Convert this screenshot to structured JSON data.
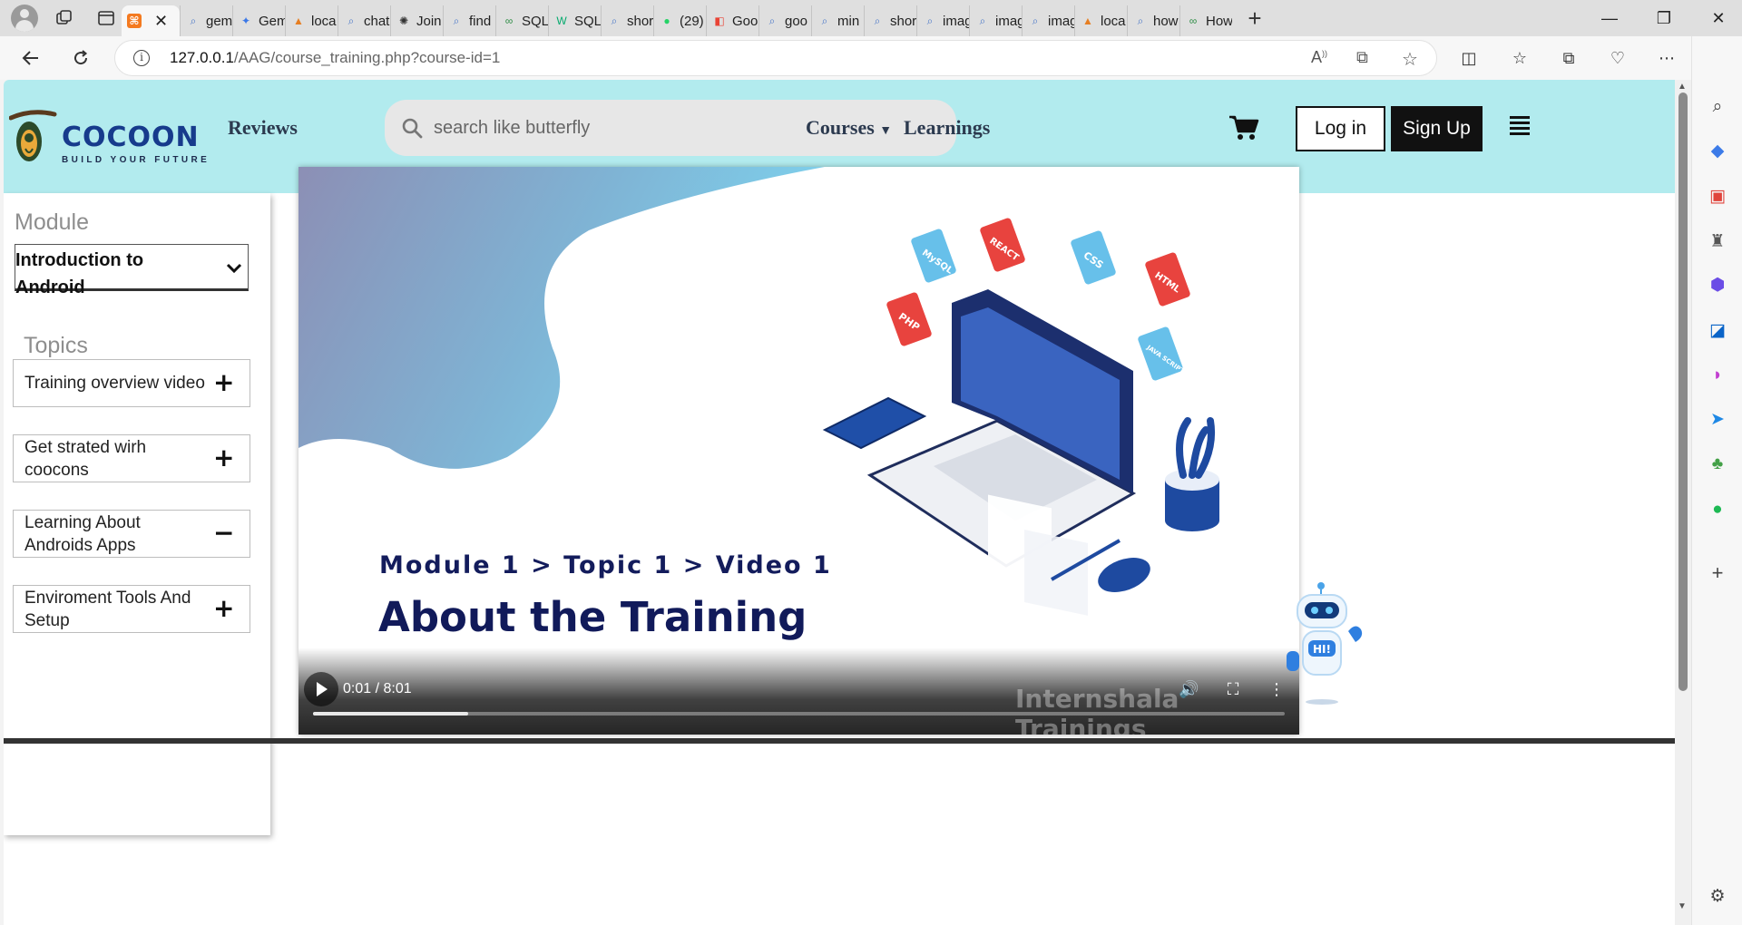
{
  "browser": {
    "tabs": [
      {
        "icon": "search-icon",
        "label": "gem"
      },
      {
        "icon": "gemini-icon",
        "label": "Gem"
      },
      {
        "icon": "phpmyadmin-icon",
        "label": "loca"
      },
      {
        "icon": "search-icon",
        "label": "chat"
      },
      {
        "icon": "chatgpt-icon",
        "label": "Join"
      },
      {
        "icon": "search-icon",
        "label": "find"
      },
      {
        "icon": "geeks-icon",
        "label": "SQL"
      },
      {
        "icon": "w3schools-icon",
        "label": "SQL"
      },
      {
        "icon": "search-icon",
        "label": "shor"
      },
      {
        "icon": "whatsapp-icon",
        "label": "(29)"
      },
      {
        "icon": "google-icon",
        "label": "Goo"
      },
      {
        "icon": "search-icon",
        "label": "goo"
      },
      {
        "icon": "search-icon",
        "label": "min"
      },
      {
        "icon": "search-icon",
        "label": "shor"
      },
      {
        "icon": "search-icon",
        "label": "imag"
      },
      {
        "icon": "search-icon",
        "label": "imag"
      },
      {
        "icon": "search-icon",
        "label": "imag"
      },
      {
        "icon": "phpmyadmin-icon",
        "label": "loca"
      },
      {
        "icon": "search-icon",
        "label": "how"
      },
      {
        "icon": "geeks-icon",
        "label": "How"
      }
    ],
    "url_host": "127.0.0.1",
    "url_path": "/AAG/course_training.php?course-id=1"
  },
  "header": {
    "logo_word": "COCOON",
    "logo_tagline": "BUILD YOUR FUTURE",
    "reviews": "Reviews",
    "search_placeholder": "search like butterfly",
    "courses": "Courses",
    "learnings": "Learnings",
    "login": "Log in",
    "signup": "Sign Up"
  },
  "sidebar": {
    "module_heading": "Module",
    "module_selected": "Introduction to Android",
    "topics_heading": "Topics",
    "topics": [
      {
        "label": "Training overview video",
        "state": "+"
      },
      {
        "label": "Get strated wirh coocons",
        "state": "+"
      },
      {
        "label": "Learning About Androids Apps",
        "state": "−"
      },
      {
        "label": "Enviroment Tools And Setup",
        "state": "+"
      }
    ]
  },
  "video": {
    "breadcrumb": "Module 1 > Topic 1 > Video 1",
    "title": "About the Training",
    "watermark": "Internshala Trainings",
    "time": "0:01 / 8:01",
    "progress": 0.16,
    "tech_tags": [
      "MySQL",
      "REACT",
      "CSS",
      "HTML",
      "PHP",
      "JAVA SCRIPT"
    ]
  },
  "chatbot": {
    "greeting": "HI!"
  },
  "colors": {
    "header_bg": "#b2ebee",
    "brand_blue": "#173b8c",
    "video_title": "#111a5a"
  }
}
